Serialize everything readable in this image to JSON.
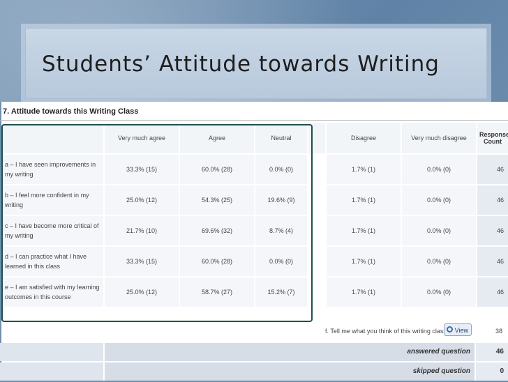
{
  "slide": {
    "title": "Students’ Attitude towards Writing"
  },
  "survey": {
    "question_title": "7. Attitude towards this Writing Class",
    "columns": [
      "Very much agree",
      "Agree",
      "Neutral",
      "Disagree",
      "Very much disagree",
      "Response Count"
    ],
    "rows": [
      {
        "label": "a – I have seen improvements in my writing",
        "values": [
          "33.3% (15)",
          "60.0% (28)",
          "0.0% (0)",
          "1.7% (1)",
          "0.0% (0)",
          "46"
        ]
      },
      {
        "label": "b – I feel more confident in my writing",
        "values": [
          "25.0% (12)",
          "54.3% (25)",
          "19.6% (9)",
          "1.7% (1)",
          "0.0% (0)",
          "46"
        ]
      },
      {
        "label": "c – I have become more critical of my writing",
        "values": [
          "21.7% (10)",
          "69.6% (32)",
          "8.7% (4)",
          "1.7% (1)",
          "0.0% (0)",
          "46"
        ]
      },
      {
        "label": "d – I can practice what I have learned in this class",
        "values": [
          "33.3% (15)",
          "60.0% (28)",
          "0.0% (0)",
          "1.7% (1)",
          "0.0% (0)",
          "46"
        ]
      },
      {
        "label": "e – I am satisfied with my learning outcomes in this course",
        "values": [
          "25.0% (12)",
          "58.7% (27)",
          "15.2% (7)",
          "1.7% (1)",
          "0.0% (0)",
          "46"
        ]
      }
    ],
    "comments": {
      "label": "f. Tell me what you think of this writing class",
      "button_label": "View",
      "count": "38"
    },
    "summary": {
      "answered_label": "answered question",
      "answered_count": "46",
      "skipped_label": "skipped question",
      "skipped_count": "0"
    }
  },
  "colors": {
    "background": "#6f8fae",
    "highlight_box": "#1d4f4f",
    "table_cell": "#f4f6f9"
  }
}
